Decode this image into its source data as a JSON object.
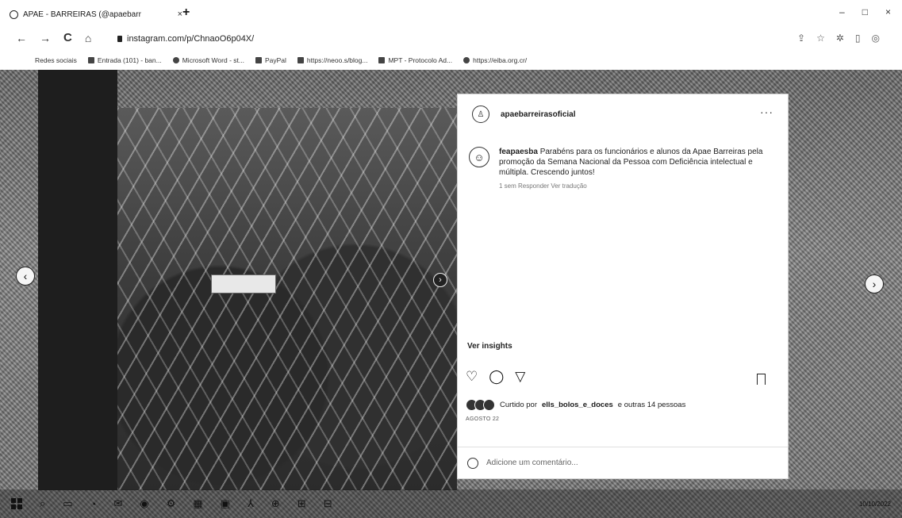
{
  "browser": {
    "tab_title": "APAE - BARREIRAS (@apaebarr",
    "tab_close": "×",
    "new_tab": "+",
    "window_controls": [
      "–",
      "□",
      "×"
    ],
    "nav": {
      "back": "←",
      "forward": "→",
      "reload": "C",
      "home": "⌂"
    },
    "url": "instagram.com/p/ChnaoO6p04X/",
    "bookmarks": [
      {
        "label": "Redes sociais",
        "icon": "apps-icon"
      },
      {
        "label": "Entrada (101) - ban...",
        "icon": "gmail-icon"
      },
      {
        "label": "Microsoft Word - st...",
        "icon": "globe-icon"
      },
      {
        "label": "PayPal",
        "icon": "paypal-icon"
      },
      {
        "label": "https://neoo.s/blog...",
        "icon": "link-icon"
      },
      {
        "label": "MPT - Protocolo Ad...",
        "icon": "mpt-icon"
      },
      {
        "label": "https://eiba.org.cr/",
        "icon": "globe-icon"
      }
    ]
  },
  "post": {
    "username": "apaebarreirasoficial",
    "more_label": "···",
    "comment": {
      "author": "feapaesba",
      "text": "Parabéns para os funcionários e alunos da Apae Barreiras pela promoção da Semana Nacional da Pessoa com Deficiência intelectual e múltipla. Crescendo juntos!",
      "meta": "1 sem   Responder   Ver tradução"
    },
    "insights_label": "Ver insights",
    "likes_text_prefix": "Curtido por",
    "likes_user": "ells_bolos_e_doces",
    "likes_text_suffix": "e outras 14 pessoas",
    "date": "AGOSTO 22",
    "comment_placeholder": "Adicione um comentário..."
  },
  "taskbar": {
    "tray_text": "10/10/2022"
  }
}
